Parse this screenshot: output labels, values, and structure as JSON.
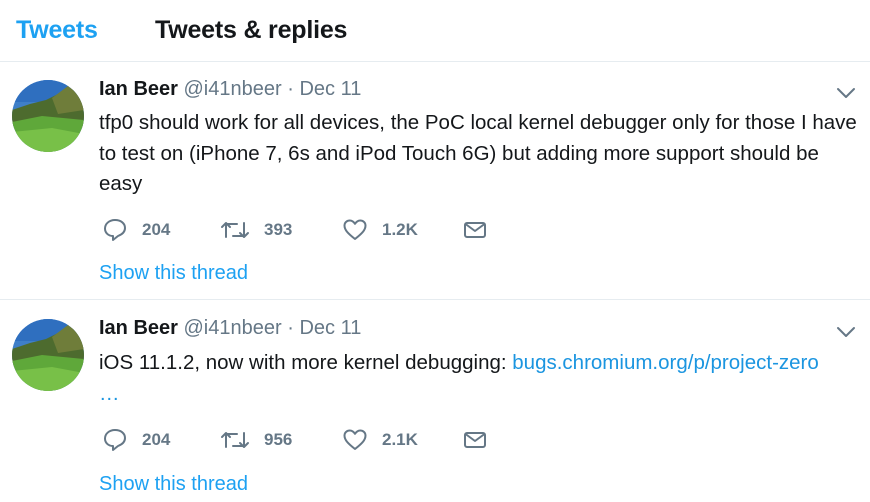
{
  "tabs": [
    {
      "label": "Tweets",
      "active": true
    },
    {
      "label": "Tweets & replies",
      "active": false
    }
  ],
  "colors": {
    "accent": "#1da1f2",
    "link": "#1b95e0",
    "muted": "#657786",
    "text": "#14171a",
    "divider": "#e6ecf0"
  },
  "tweets": [
    {
      "name": "Ian Beer",
      "handle": "@i41nbeer",
      "separator": "·",
      "date": "Dec 11",
      "text": "tfp0 should work for all devices, the PoC local kernel debugger only for those I have to test on (iPhone 7, 6s and iPod Touch 6G) but adding more support should be easy",
      "link": "",
      "ellipsis": "",
      "replies": "204",
      "retweets": "393",
      "likes": "1.2K",
      "thread_label": "Show this thread"
    },
    {
      "name": "Ian Beer",
      "handle": "@i41nbeer",
      "separator": "·",
      "date": "Dec 11",
      "text": "iOS 11.1.2, now with more kernel debugging: ",
      "link": "bugs.chromium.org/p/project-zero",
      "ellipsis": "…",
      "replies": "204",
      "retweets": "956",
      "likes": "2.1K",
      "thread_label": "Show this thread"
    }
  ],
  "icons": {
    "avatar": "landscape-photo-avatar",
    "menu": "chevron-down-icon",
    "reply": "reply-bubble-icon",
    "retweet": "retweet-icon",
    "like": "heart-icon",
    "message": "envelope-icon"
  }
}
